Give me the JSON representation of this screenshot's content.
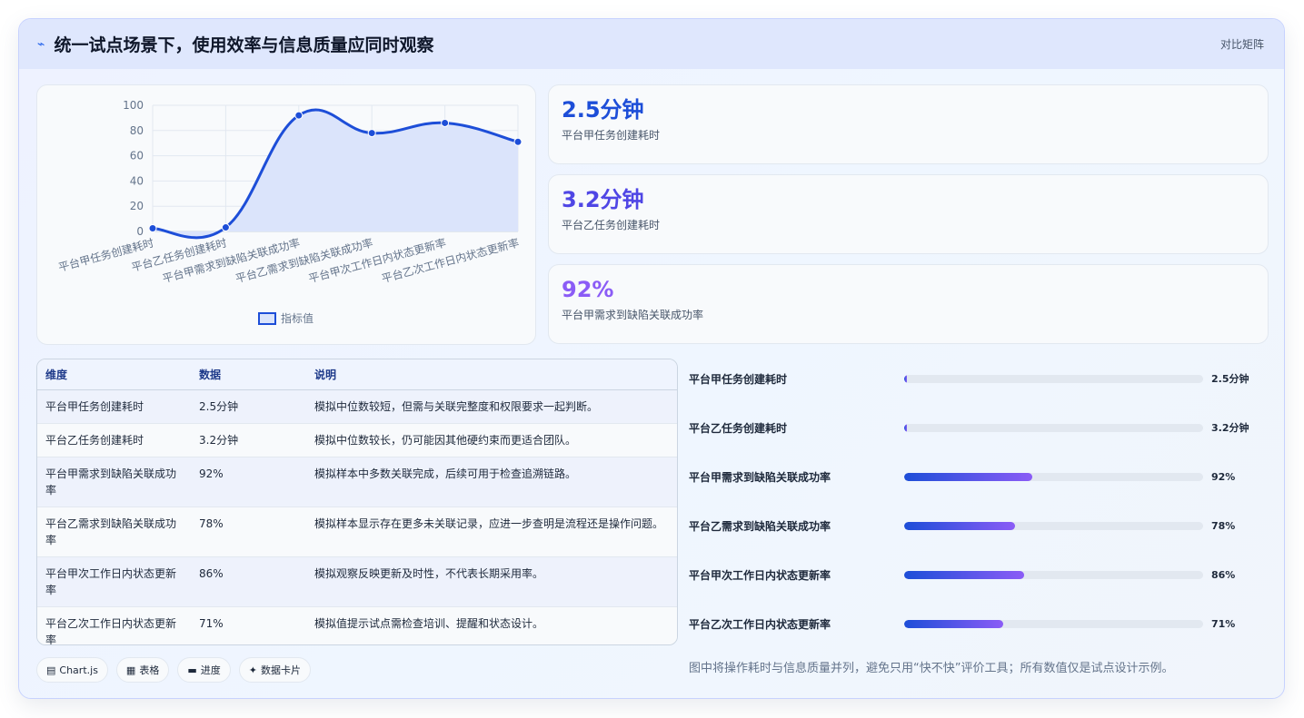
{
  "header": {
    "title": "统一试点场景下，使用效率与信息质量应同时观察",
    "title_icon": "pulse-icon",
    "tag": "对比矩阵"
  },
  "chart_data": {
    "type": "line",
    "categories": [
      "平台甲任务创建耗时",
      "平台乙任务创建耗时",
      "平台甲需求到缺陷关联成功率",
      "平台乙需求到缺陷关联成功率",
      "平台甲次工作日内状态更新率",
      "平台乙次工作日内状态更新率"
    ],
    "series": [
      {
        "name": "指标值",
        "values": [
          2.5,
          3.2,
          92,
          78,
          86,
          71
        ],
        "color": "#1d4ed8",
        "fill": "#dbe4fb"
      }
    ],
    "y_ticks": [
      "0",
      "20",
      "40",
      "60",
      "80",
      "100"
    ],
    "ylim": [
      0,
      100
    ],
    "grid": true,
    "legend_position": "bottom"
  },
  "kpis": [
    {
      "value": "2.5分钟",
      "label": "平台甲任务创建耗时",
      "color": "#1d4ed8"
    },
    {
      "value": "3.2分钟",
      "label": "平台乙任务创建耗时",
      "color": "#4f46e5"
    },
    {
      "value": "92%",
      "label": "平台甲需求到缺陷关联成功率",
      "color": "#8b5cf6"
    }
  ],
  "table": {
    "headers": [
      "维度",
      "数据",
      "说明"
    ],
    "rows": [
      [
        "平台甲任务创建耗时",
        "2.5分钟",
        "模拟中位数较短，但需与关联完整度和权限要求一起判断。"
      ],
      [
        "平台乙任务创建耗时",
        "3.2分钟",
        "模拟中位数较长，仍可能因其他硬约束而更适合团队。"
      ],
      [
        "平台甲需求到缺陷关联成功率",
        "92%",
        "模拟样本中多数关联完成，后续可用于检查追溯链路。"
      ],
      [
        "平台乙需求到缺陷关联成功率",
        "78%",
        "模拟样本显示存在更多未关联记录，应进一步查明是流程还是操作问题。"
      ],
      [
        "平台甲次工作日内状态更新率",
        "86%",
        "模拟观察反映更新及时性，不代表长期采用率。"
      ],
      [
        "平台乙次工作日内状态更新率",
        "71%",
        "模拟值提示试点需检查培训、提醒和状态设计。"
      ]
    ]
  },
  "progress": [
    {
      "label": "平台甲任务创建耗时",
      "value": "2.5分钟",
      "fraction": 0.01
    },
    {
      "label": "平台乙任务创建耗时",
      "value": "3.2分钟",
      "fraction": 0.01
    },
    {
      "label": "平台甲需求到缺陷关联成功率",
      "value": "92%",
      "fraction": 0.43
    },
    {
      "label": "平台乙需求到缺陷关联成功率",
      "value": "78%",
      "fraction": 0.37
    },
    {
      "label": "平台甲次工作日内状态更新率",
      "value": "86%",
      "fraction": 0.4
    },
    {
      "label": "平台乙次工作日内状态更新率",
      "value": "71%",
      "fraction": 0.33
    }
  ],
  "chips": [
    {
      "icon": "chart-icon",
      "glyph": "▤",
      "label": "Chart.js"
    },
    {
      "icon": "table-icon",
      "glyph": "▦",
      "label": "表格"
    },
    {
      "icon": "progress-icon",
      "glyph": "▬",
      "label": "进度"
    },
    {
      "icon": "sparkle-icon",
      "glyph": "✦",
      "label": "数据卡片"
    }
  ],
  "footnote": "图中将操作耗时与信息质量并列，避免只用“快不快”评价工具；所有数值仅是试点设计示例。"
}
